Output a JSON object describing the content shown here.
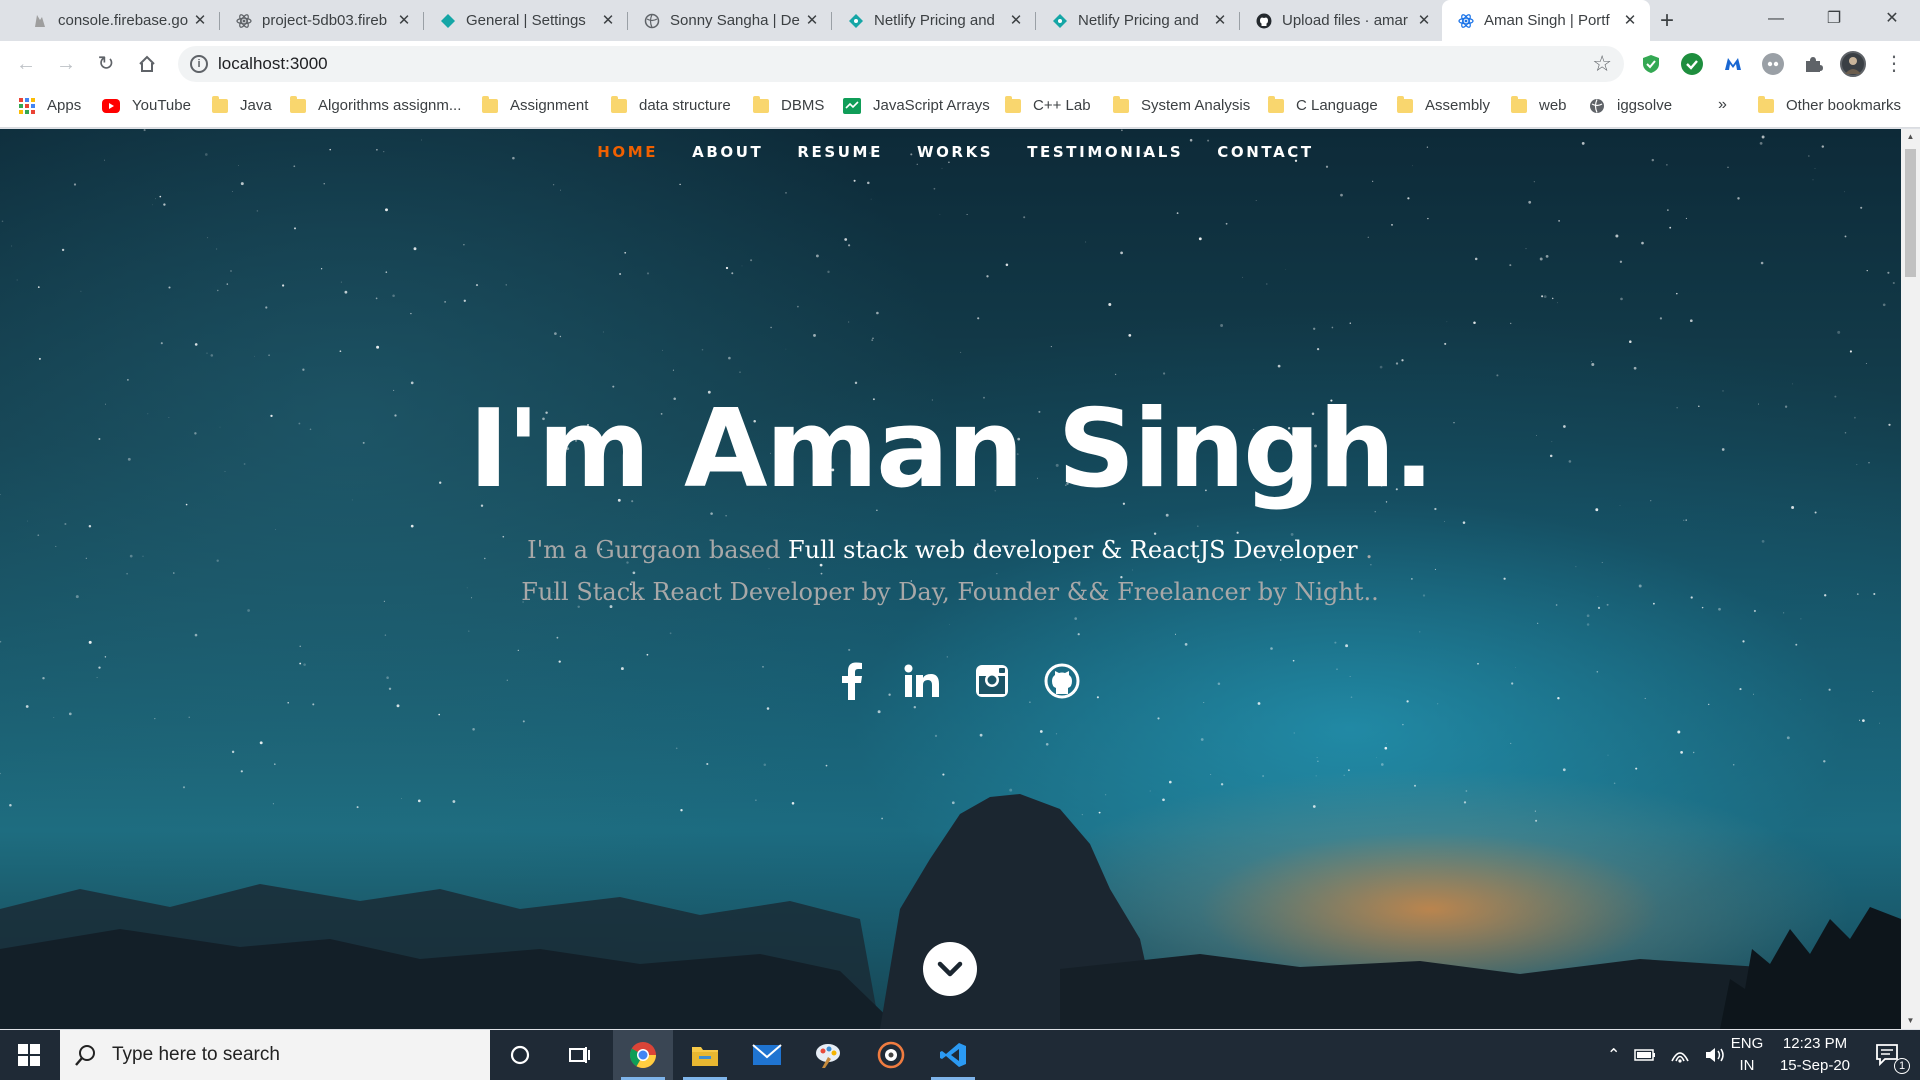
{
  "browser": {
    "tabs": [
      {
        "title": "console.firebase.go",
        "icon": "firebase-icon"
      },
      {
        "title": "project-5db03.fireb",
        "icon": "react-icon"
      },
      {
        "title": "General | Settings",
        "icon": "netlify-icon"
      },
      {
        "title": "Sonny Sangha | De",
        "icon": "globe-icon"
      },
      {
        "title": "Netlify Pricing and",
        "icon": "netlify-icon"
      },
      {
        "title": "Netlify Pricing and",
        "icon": "netlify-icon"
      },
      {
        "title": "Upload files · amar",
        "icon": "github-icon"
      },
      {
        "title": "Aman Singh | Portf",
        "icon": "react-icon",
        "active": true
      }
    ],
    "new_tab_label": "+",
    "address": "localhost:3000",
    "bookmarks": [
      {
        "label": "Apps",
        "icon": "apps-grid-icon"
      },
      {
        "label": "YouTube",
        "icon": "youtube-icon"
      },
      {
        "label": "Java",
        "icon": "folder-icon"
      },
      {
        "label": "Algorithms assignm...",
        "icon": "folder-icon"
      },
      {
        "label": "Assignment",
        "icon": "folder-icon"
      },
      {
        "label": "data structure",
        "icon": "folder-icon"
      },
      {
        "label": "DBMS",
        "icon": "folder-icon"
      },
      {
        "label": "JavaScript Arrays",
        "icon": "sheet-icon"
      },
      {
        "label": "C++ Lab",
        "icon": "folder-icon"
      },
      {
        "label": "System Analysis",
        "icon": "folder-icon"
      },
      {
        "label": "C Language",
        "icon": "folder-icon"
      },
      {
        "label": "Assembly",
        "icon": "folder-icon"
      },
      {
        "label": "web",
        "icon": "folder-icon"
      },
      {
        "label": "iggsolve",
        "icon": "globe-icon"
      }
    ],
    "bookmarks_overflow": "»",
    "other_bookmarks": "Other bookmarks"
  },
  "site": {
    "nav": [
      {
        "label": "HOME",
        "current": true
      },
      {
        "label": "ABOUT"
      },
      {
        "label": "RESUME"
      },
      {
        "label": "WORKS"
      },
      {
        "label": "TESTIMONIALS"
      },
      {
        "label": "CONTACT"
      }
    ],
    "title": "I'm Aman Singh.",
    "subtitle_pre": "I'm a Gurgaon based ",
    "subtitle_highlight": "Full stack web developer & ReactJS Developer",
    "subtitle_post": " . Full Stack React Developer by Day, Founder && Freelancer by Night..",
    "social": [
      "facebook-icon",
      "linkedin-icon",
      "instagram-icon",
      "github-icon"
    ],
    "accent_color": "#f06000"
  },
  "taskbar": {
    "search_placeholder": "Type here to search",
    "apps": [
      "cortana-icon",
      "task-view-icon",
      "chrome-icon",
      "file-explorer-icon",
      "mail-icon",
      "paint-icon",
      "media-player-icon",
      "vscode-icon"
    ],
    "lang_line1": "ENG",
    "lang_line2": "IN",
    "time": "12:23 PM",
    "date": "15-Sep-20",
    "notification_count": "1"
  }
}
